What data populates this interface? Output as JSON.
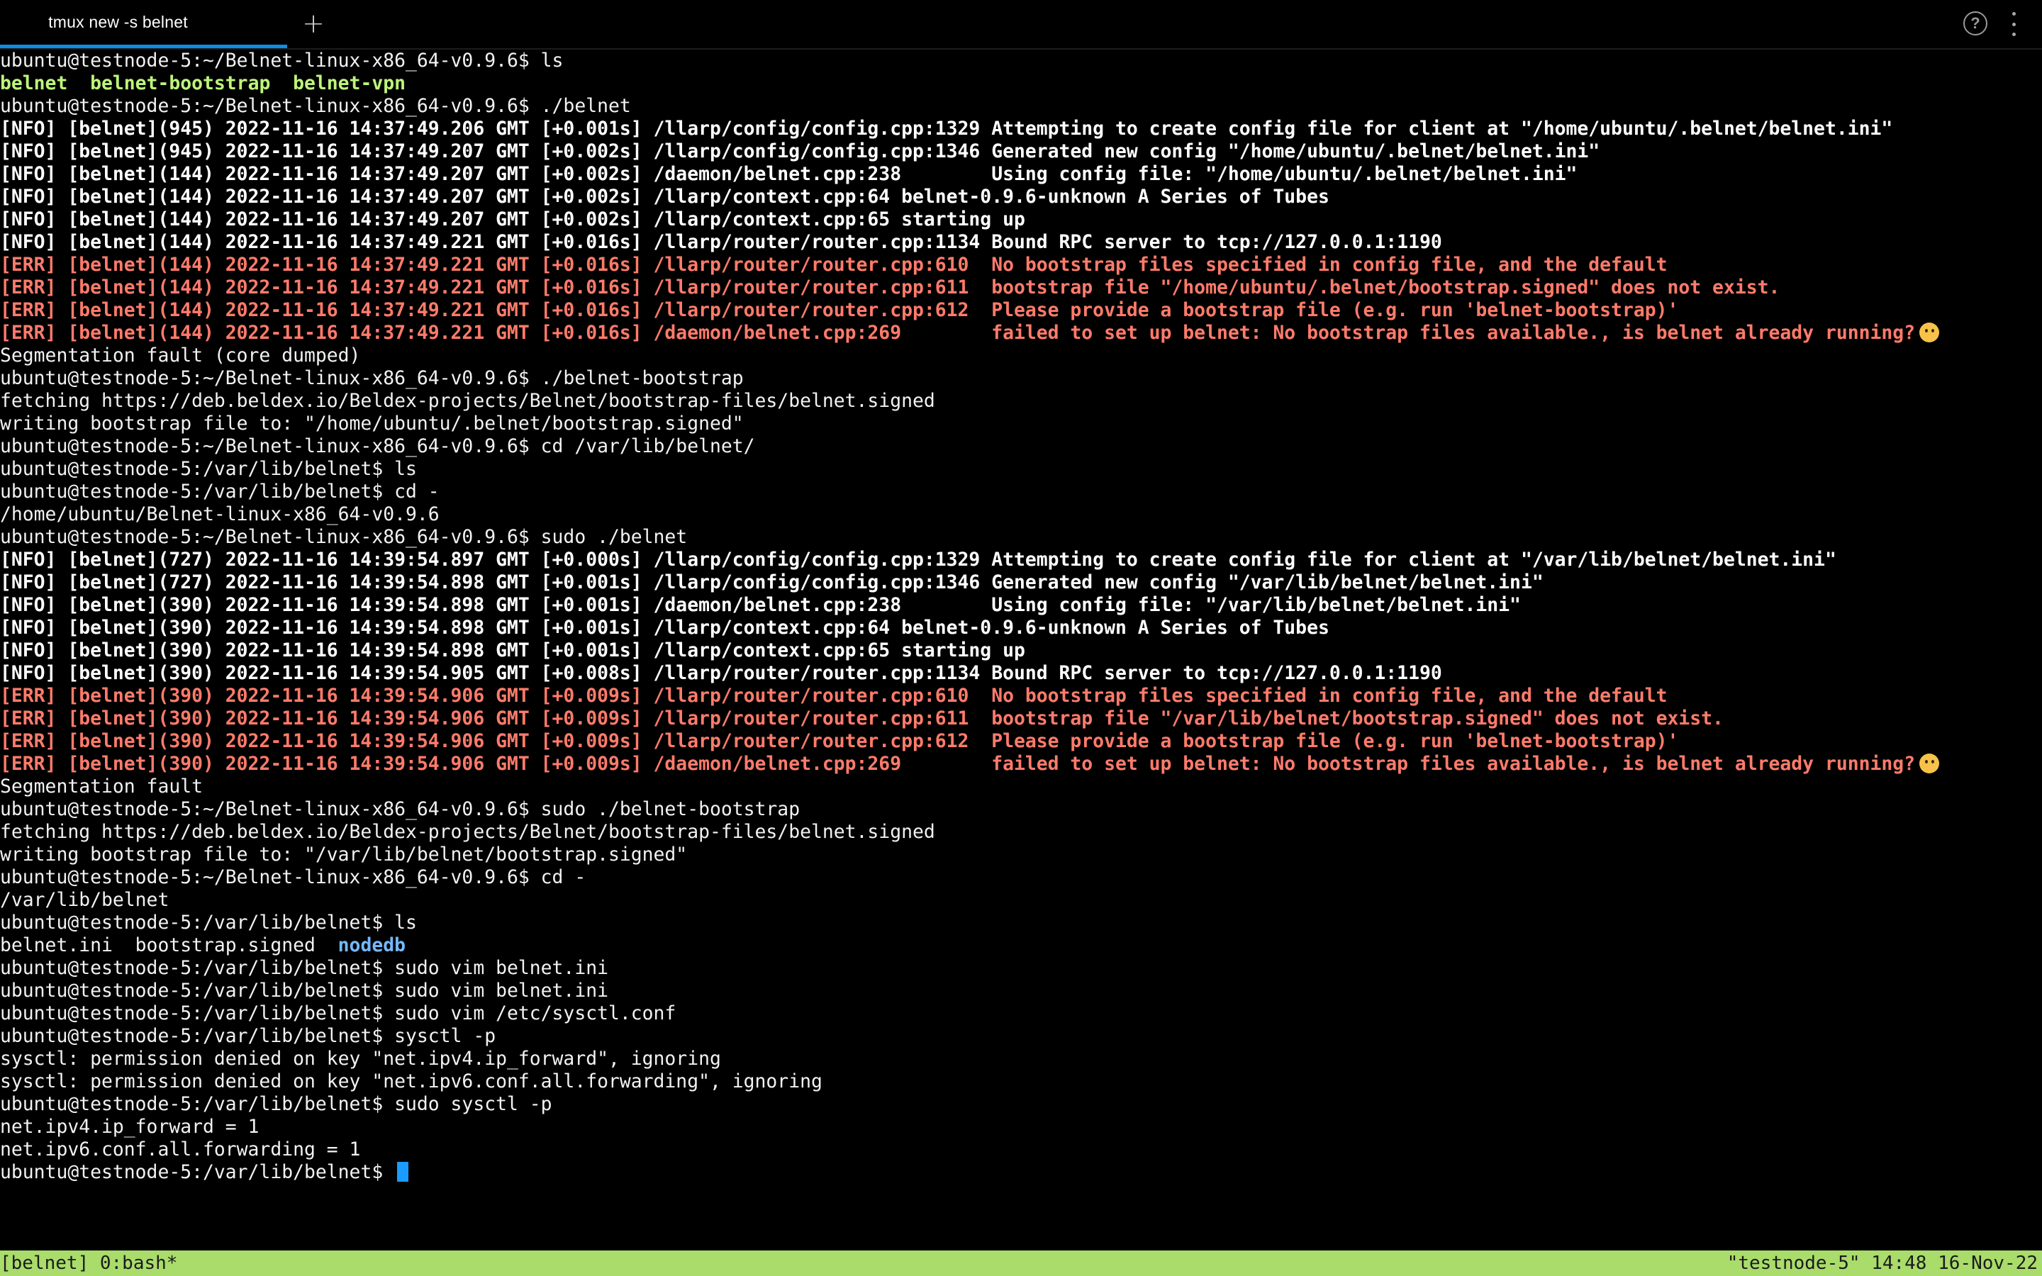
{
  "tab": {
    "title": "tmux new -s belnet",
    "new_tab_symbol": "+"
  },
  "icons": {
    "help": "?",
    "menu": "kebab-menu-icon"
  },
  "colors": {
    "background": "#000000",
    "tab_underline": "#0c8ce9",
    "error_text": "#ff7b6b",
    "dir_green": "#bdf57a",
    "dir_blue": "#73b9ff",
    "cursor": "#1a9bff",
    "statusbar": "#a9dc6a"
  },
  "terminal": {
    "lines": [
      "ubuntu@testnode-5:~/Belnet-linux-x86_64-v0.9.6$ ls",
      "",
      "ubuntu@testnode-5:~/Belnet-linux-x86_64-v0.9.6$ ./belnet",
      "[NFO] [belnet](945) 2022-11-16 14:37:49.206 GMT [+0.001s] /llarp/config/config.cpp:1329 Attempting to create config file for client at \"/home/ubuntu/.belnet/belnet.ini\"",
      "[NFO] [belnet](945) 2022-11-16 14:37:49.207 GMT [+0.002s] /llarp/config/config.cpp:1346 Generated new config \"/home/ubuntu/.belnet/belnet.ini\"",
      "[NFO] [belnet](144) 2022-11-16 14:37:49.207 GMT [+0.002s] /daemon/belnet.cpp:238        Using config file: \"/home/ubuntu/.belnet/belnet.ini\"",
      "[NFO] [belnet](144) 2022-11-16 14:37:49.207 GMT [+0.002s] /llarp/context.cpp:64 belnet-0.9.6-unknown A Series of Tubes",
      "[NFO] [belnet](144) 2022-11-16 14:37:49.207 GMT [+0.002s] /llarp/context.cpp:65 starting up",
      "[NFO] [belnet](144) 2022-11-16 14:37:49.221 GMT [+0.016s] /llarp/router/router.cpp:1134 Bound RPC server to tcp://127.0.0.1:1190",
      "[ERR] [belnet](144) 2022-11-16 14:37:49.221 GMT [+0.016s] /llarp/router/router.cpp:610  No bootstrap files specified in config file, and the default",
      "[ERR] [belnet](144) 2022-11-16 14:37:49.221 GMT [+0.016s] /llarp/router/router.cpp:611  bootstrap file \"/home/ubuntu/.belnet/bootstrap.signed\" does not exist.",
      "[ERR] [belnet](144) 2022-11-16 14:37:49.221 GMT [+0.016s] /llarp/router/router.cpp:612  Please provide a bootstrap file (e.g. run 'belnet-bootstrap)'",
      "[ERR] [belnet](144) 2022-11-16 14:37:49.221 GMT [+0.016s] /daemon/belnet.cpp:269        failed to set up belnet: No bootstrap files available., is belnet already running?",
      "Segmentation fault (core dumped)",
      "ubuntu@testnode-5:~/Belnet-linux-x86_64-v0.9.6$ ./belnet-bootstrap",
      "fetching https://deb.beldex.io/Beldex-projects/Belnet/bootstrap-files/belnet.signed",
      "writing bootstrap file to: \"/home/ubuntu/.belnet/bootstrap.signed\"",
      "ubuntu@testnode-5:~/Belnet-linux-x86_64-v0.9.6$ cd /var/lib/belnet/",
      "ubuntu@testnode-5:/var/lib/belnet$ ls",
      "ubuntu@testnode-5:/var/lib/belnet$ cd -",
      "/home/ubuntu/Belnet-linux-x86_64-v0.9.6",
      "ubuntu@testnode-5:~/Belnet-linux-x86_64-v0.9.6$ sudo ./belnet",
      "[NFO] [belnet](727) 2022-11-16 14:39:54.897 GMT [+0.000s] /llarp/config/config.cpp:1329 Attempting to create config file for client at \"/var/lib/belnet/belnet.ini\"",
      "[NFO] [belnet](727) 2022-11-16 14:39:54.898 GMT [+0.001s] /llarp/config/config.cpp:1346 Generated new config \"/var/lib/belnet/belnet.ini\"",
      "[NFO] [belnet](390) 2022-11-16 14:39:54.898 GMT [+0.001s] /daemon/belnet.cpp:238        Using config file: \"/var/lib/belnet/belnet.ini\"",
      "[NFO] [belnet](390) 2022-11-16 14:39:54.898 GMT [+0.001s] /llarp/context.cpp:64 belnet-0.9.6-unknown A Series of Tubes",
      "[NFO] [belnet](390) 2022-11-16 14:39:54.898 GMT [+0.001s] /llarp/context.cpp:65 starting up",
      "[NFO] [belnet](390) 2022-11-16 14:39:54.905 GMT [+0.008s] /llarp/router/router.cpp:1134 Bound RPC server to tcp://127.0.0.1:1190",
      "[ERR] [belnet](390) 2022-11-16 14:39:54.906 GMT [+0.009s] /llarp/router/router.cpp:610  No bootstrap files specified in config file, and the default",
      "[ERR] [belnet](390) 2022-11-16 14:39:54.906 GMT [+0.009s] /llarp/router/router.cpp:611  bootstrap file \"/var/lib/belnet/bootstrap.signed\" does not exist.",
      "[ERR] [belnet](390) 2022-11-16 14:39:54.906 GMT [+0.009s] /llarp/router/router.cpp:612  Please provide a bootstrap file (e.g. run 'belnet-bootstrap)'",
      "[ERR] [belnet](390) 2022-11-16 14:39:54.906 GMT [+0.009s] /daemon/belnet.cpp:269        failed to set up belnet: No bootstrap files available., is belnet already running?",
      "Segmentation fault",
      "ubuntu@testnode-5:~/Belnet-linux-x86_64-v0.9.6$ sudo ./belnet-bootstrap",
      "fetching https://deb.beldex.io/Beldex-projects/Belnet/bootstrap-files/belnet.signed",
      "writing bootstrap file to: \"/var/lib/belnet/bootstrap.signed\"",
      "ubuntu@testnode-5:~/Belnet-linux-x86_64-v0.9.6$ cd -",
      "/var/lib/belnet",
      "ubuntu@testnode-5:/var/lib/belnet$ ls",
      "",
      "ubuntu@testnode-5:/var/lib/belnet$ sudo vim belnet.ini",
      "ubuntu@testnode-5:/var/lib/belnet$ sudo vim belnet.ini",
      "ubuntu@testnode-5:/var/lib/belnet$ sudo vim /etc/sysctl.conf",
      "ubuntu@testnode-5:/var/lib/belnet$ sysctl -p",
      "sysctl: permission denied on key \"net.ipv4.ip_forward\", ignoring",
      "sysctl: permission denied on key \"net.ipv6.conf.all.forwarding\", ignoring",
      "ubuntu@testnode-5:/var/lib/belnet$ sudo sysctl -p",
      "net.ipv4.ip_forward = 1",
      "net.ipv6.conf.all.forwarding = 1",
      "ubuntu@testnode-5:/var/lib/belnet$ "
    ],
    "ls_output_1": {
      "item1": "belnet",
      "sep1": "  ",
      "item2": "belnet-bootstrap",
      "sep2": "  ",
      "item3": "belnet-vpn"
    },
    "ls_output_2": {
      "item1": "belnet.ini",
      "sep1": "  ",
      "item2": "bootstrap.signed",
      "sep2": "  ",
      "item3": "nodedb"
    }
  },
  "statusbar": {
    "left": "[belnet] 0:bash*",
    "right": "\"testnode-5\" 14:48 16-Nov-22"
  }
}
